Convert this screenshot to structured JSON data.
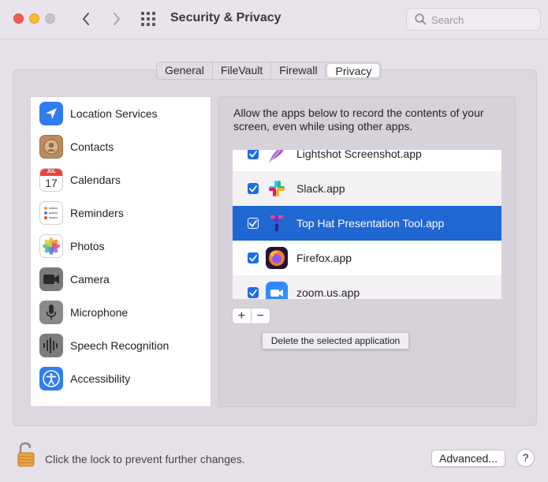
{
  "window": {
    "title": "Security & Privacy",
    "search_placeholder": "Search"
  },
  "tabs": [
    {
      "label": "General",
      "active": false
    },
    {
      "label": "FileVault",
      "active": false
    },
    {
      "label": "Firewall",
      "active": false
    },
    {
      "label": "Privacy",
      "active": true
    }
  ],
  "categories": [
    {
      "label": "Location Services",
      "icon": "location-arrow-icon"
    },
    {
      "label": "Contacts",
      "icon": "contacts-icon"
    },
    {
      "label": "Calendars",
      "icon": "calendar-icon",
      "icon_month": "JUL",
      "icon_day": "17"
    },
    {
      "label": "Reminders",
      "icon": "reminders-icon"
    },
    {
      "label": "Photos",
      "icon": "photos-icon"
    },
    {
      "label": "Camera",
      "icon": "camera-icon"
    },
    {
      "label": "Microphone",
      "icon": "microphone-icon"
    },
    {
      "label": "Speech Recognition",
      "icon": "speech-waveform-icon"
    },
    {
      "label": "Accessibility",
      "icon": "accessibility-icon"
    }
  ],
  "privacy": {
    "description": "Allow the apps below to record the contents of your screen, even while using other apps.",
    "apps": [
      {
        "name": "Lightshot Screenshot.app",
        "checked": true,
        "icon": "lightshot-feather-icon"
      },
      {
        "name": "Slack.app",
        "checked": true,
        "icon": "slack-icon"
      },
      {
        "name": "Top Hat Presentation Tool.app",
        "checked": true,
        "selected": true,
        "icon": "tophat-icon"
      },
      {
        "name": "Firefox.app",
        "checked": true,
        "icon": "firefox-icon"
      },
      {
        "name": "zoom.us.app",
        "checked": true,
        "icon": "zoom-camera-icon"
      }
    ],
    "add_label": "+",
    "remove_label": "−",
    "tooltip": "Delete the selected application"
  },
  "footer": {
    "lock_text": "Click the lock to prevent further changes.",
    "advanced_label": "Advanced...",
    "help_label": "?"
  },
  "colors": {
    "selection": "#1f67d2",
    "checkbox": "#1a6ee6"
  }
}
